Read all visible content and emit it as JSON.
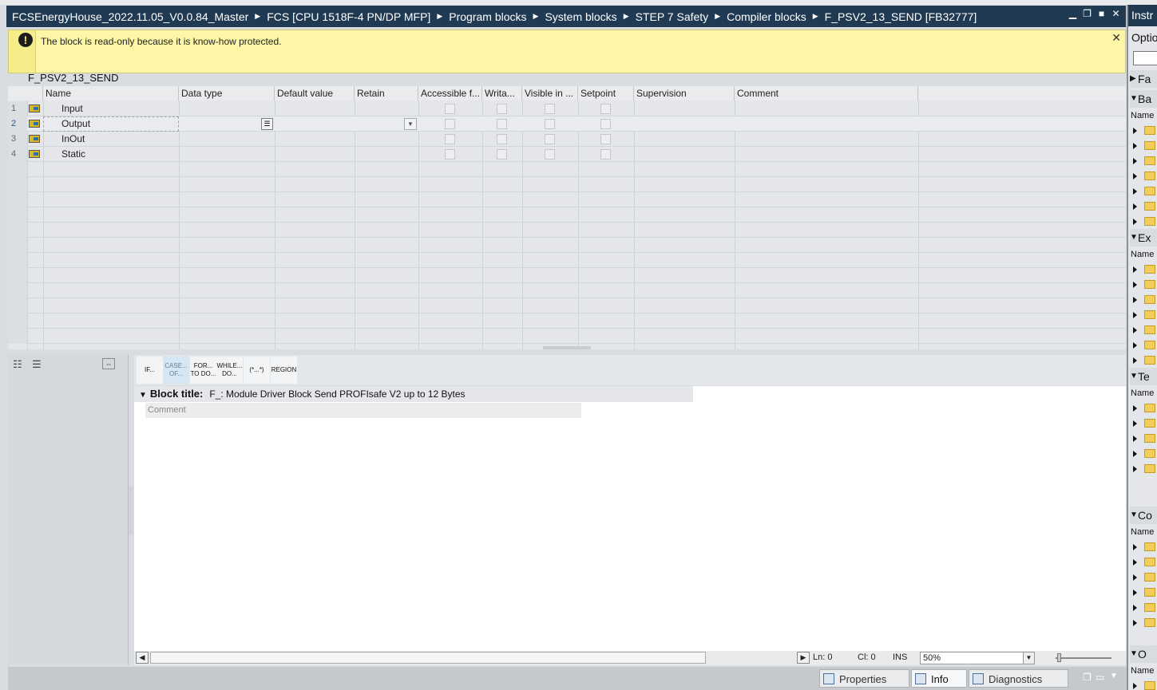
{
  "window": {
    "breadcrumb": [
      "FCSEnergyHouse_2022.11.05_V0.0.84_Master",
      "FCS [CPU 1518F-4 PN/DP MFP]",
      "Program blocks",
      "System blocks",
      "STEP 7 Safety",
      "Compiler blocks",
      "F_PSV2_13_SEND [FB32777]"
    ]
  },
  "banner": {
    "message": "The block is read-only because it is know-how protected."
  },
  "block": {
    "name": "F_PSV2_13_SEND"
  },
  "interface_table": {
    "columns": [
      "Name",
      "Data type",
      "Default value",
      "Retain",
      "Accessible f...",
      "Writa...",
      "Visible in ...",
      "Setpoint",
      "Supervision",
      "Comment"
    ],
    "rows": [
      {
        "num": "1",
        "name": "Input"
      },
      {
        "num": "2",
        "name": "Output"
      },
      {
        "num": "3",
        "name": "InOut"
      },
      {
        "num": "4",
        "name": "Static"
      }
    ]
  },
  "keywords": [
    {
      "l1": "IF...",
      "l2": ""
    },
    {
      "l1": "CASE...",
      "l2": "OF..."
    },
    {
      "l1": "FOR...",
      "l2": "TO DO..."
    },
    {
      "l1": "WHILE...",
      "l2": "DO..."
    },
    {
      "l1": "(*...*)",
      "l2": ""
    },
    {
      "l1": "REGION",
      "l2": ""
    }
  ],
  "editor": {
    "block_title_label": "Block title:",
    "block_title_value": "F_: Module Driver Block Send PROFIsafe V2 up to 12 Bytes",
    "comment_placeholder": "Comment"
  },
  "statusbar": {
    "ln": "Ln: 0",
    "cl": "Cl: 0",
    "mode": "INS",
    "zoom": "50%"
  },
  "bottom_tabs": {
    "properties": "Properties",
    "info": "Info",
    "diagnostics": "Diagnostics"
  },
  "right_pane": {
    "title": "Instr",
    "options": "Optio",
    "sections": [
      {
        "label": "Fa"
      },
      {
        "label": "Ba"
      },
      {
        "label": "Ex"
      },
      {
        "label": "Te"
      },
      {
        "label": "Co"
      },
      {
        "label": "O"
      }
    ],
    "name_label": "Name"
  }
}
